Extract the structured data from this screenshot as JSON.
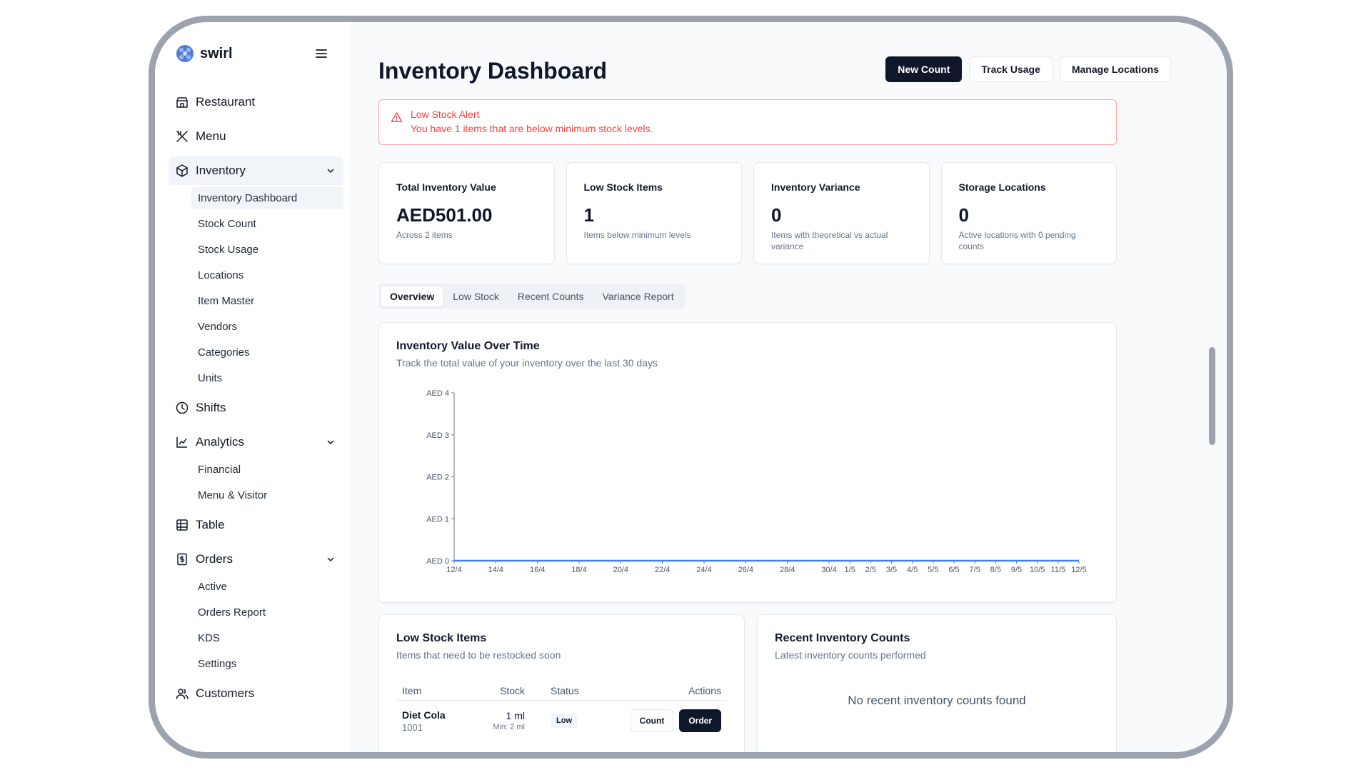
{
  "brand": {
    "name": "swirl"
  },
  "sidebar": {
    "items": [
      {
        "label": "Restaurant",
        "icon": "store-icon"
      },
      {
        "label": "Menu",
        "icon": "utensils-icon"
      },
      {
        "label": "Inventory",
        "icon": "box-icon",
        "expanded": true,
        "children": [
          "Inventory Dashboard",
          "Stock Count",
          "Stock Usage",
          "Locations",
          "Item Master",
          "Vendors",
          "Categories",
          "Units"
        ]
      },
      {
        "label": "Shifts",
        "icon": "clock-icon"
      },
      {
        "label": "Analytics",
        "icon": "chart-line-icon",
        "expanded": true,
        "children": [
          "Financial",
          "Menu & Visitor"
        ]
      },
      {
        "label": "Table",
        "icon": "table-icon"
      },
      {
        "label": "Orders",
        "icon": "receipt-icon",
        "expanded": true,
        "children": [
          "Active",
          "Orders Report",
          "KDS",
          "Settings"
        ]
      },
      {
        "label": "Customers",
        "icon": "users-icon"
      }
    ]
  },
  "header": {
    "title": "Inventory Dashboard",
    "actions": {
      "new_count": "New Count",
      "track_usage": "Track Usage",
      "manage_locations": "Manage Locations"
    }
  },
  "alert": {
    "title": "Low Stock Alert",
    "text": "You have 1 items that are below minimum stock levels."
  },
  "stats": [
    {
      "label": "Total Inventory Value",
      "value": "AED501.00",
      "sub": "Across 2 items"
    },
    {
      "label": "Low Stock Items",
      "value": "1",
      "sub": "Items below minimum levels"
    },
    {
      "label": "Inventory Variance",
      "value": "0",
      "sub": "Items with theoretical vs actual variance"
    },
    {
      "label": "Storage Locations",
      "value": "0",
      "sub": "Active locations with 0 pending counts"
    }
  ],
  "tabs": [
    "Overview",
    "Low Stock",
    "Recent Counts",
    "Variance Report"
  ],
  "chart_card": {
    "title": "Inventory Value Over Time",
    "desc": "Track the total value of your inventory over the last 30 days"
  },
  "chart_data": {
    "type": "line",
    "title": "Inventory Value Over Time",
    "x": [
      "12/4",
      "14/4",
      "16/4",
      "18/4",
      "20/4",
      "22/4",
      "24/4",
      "26/4",
      "28/4",
      "30/4",
      "1/5",
      "2/5",
      "3/5",
      "4/5",
      "5/5",
      "6/5",
      "7/5",
      "8/5",
      "9/5",
      "10/5",
      "11/5",
      "12/5"
    ],
    "series": [
      {
        "values": [
          0,
          0,
          0,
          0,
          0,
          0,
          0,
          0,
          0,
          0,
          0,
          0,
          0,
          0,
          0,
          0,
          0,
          0,
          0,
          0,
          0,
          0
        ]
      }
    ],
    "ylim": [
      0,
      4
    ],
    "yticks": [
      "AED 0",
      "AED 1",
      "AED 2",
      "AED 3",
      "AED 4"
    ],
    "line_color": "#3b82f6",
    "grid": false
  },
  "low_stock": {
    "title": "Low Stock Items",
    "desc": "Items that need to be restocked soon",
    "columns": [
      "Item",
      "Stock",
      "Status",
      "Actions"
    ],
    "rows": [
      {
        "name": "Diet Cola",
        "code": "1001",
        "stock": "1 ml",
        "min": "Min: 2 ml",
        "status": "Low",
        "count_label": "Count",
        "order_label": "Order"
      }
    ]
  },
  "recent": {
    "title": "Recent Inventory Counts",
    "desc": "Latest inventory counts performed",
    "empty": "No recent inventory counts found"
  }
}
